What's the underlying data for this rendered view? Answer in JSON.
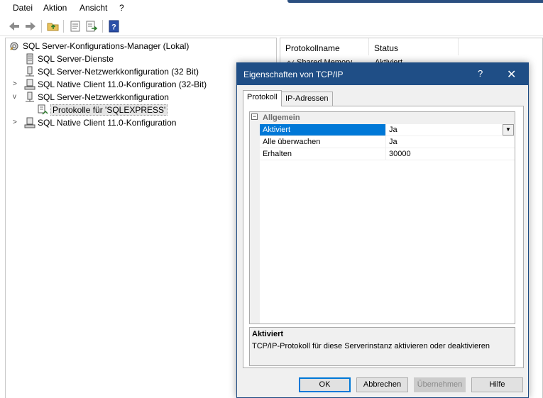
{
  "menu": [
    "Datei",
    "Aktion",
    "Ansicht",
    "?"
  ],
  "toolbar": {
    "buttons": [
      "back-arrow-icon",
      "forward-arrow-icon",
      "up-folder-icon",
      "properties-icon",
      "export-list-icon",
      "help-icon"
    ]
  },
  "tree": {
    "root": "SQL Server-Konfigurations-Manager (Lokal)",
    "items": [
      {
        "label": "SQL Server-Dienste",
        "expander": ""
      },
      {
        "label": "SQL Server-Netzwerkkonfiguration (32 Bit)",
        "expander": ""
      },
      {
        "label": "SQL Native Client 11.0-Konfiguration (32-Bit)",
        "expander": ">"
      },
      {
        "label": "SQL Server-Netzwerkkonfiguration",
        "expander": "v"
      },
      {
        "label": "Protokolle für 'SQLEXPRESS'",
        "expander": ""
      },
      {
        "label": "SQL Native Client 11.0-Konfiguration",
        "expander": ">"
      }
    ]
  },
  "list": {
    "columns": [
      "Protokollname",
      "Status"
    ],
    "rows": [
      {
        "name": "Shared Memory",
        "status": "Aktiviert"
      }
    ]
  },
  "dialog": {
    "title": "Eigenschaften von TCP/IP",
    "help_glyph": "?",
    "close_glyph": "✕",
    "tabs": [
      "Protokoll",
      "IP-Adressen"
    ],
    "category": "Allgemein",
    "category_toggle": "−",
    "properties": [
      {
        "name": "Aktiviert",
        "value": "Ja"
      },
      {
        "name": "Alle überwachen",
        "value": "Ja"
      },
      {
        "name": "Erhalten",
        "value": "30000"
      }
    ],
    "dropdown_glyph": "▼",
    "description": {
      "title": "Aktiviert",
      "text": "TCP/IP-Protokoll für diese Serverinstanz aktivieren oder deaktivieren"
    },
    "buttons": {
      "ok": "OK",
      "cancel": "Abbrechen",
      "apply": "Übernehmen",
      "help": "Hilfe"
    }
  },
  "colors": {
    "dialog_title_bg": "#1f4e86",
    "selection": "#0078d7"
  }
}
